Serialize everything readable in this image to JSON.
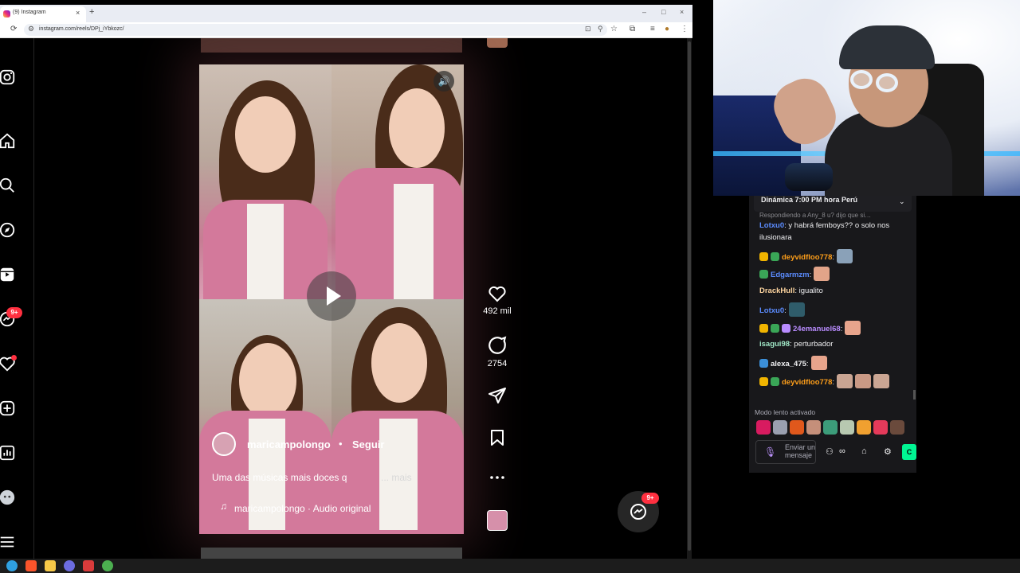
{
  "browser": {
    "tab_title": "(9) Instagram",
    "tab_close": "×",
    "new_tab": "+",
    "url": "instagram.com/reels/DPj_iYbkozc/",
    "win_min": "–",
    "win_max": "□",
    "win_close": "×"
  },
  "sidebar": {
    "messages_badge": "9+"
  },
  "reel": {
    "author": "maricampolongo",
    "separator": "•",
    "follow_label": "Seguir",
    "caption": "Uma das músicas mais doces q",
    "caption_more": "... mais",
    "audio": "maricampolongo · Audio original"
  },
  "actions": {
    "likes": "492 mil",
    "comments": "2754"
  },
  "fab": {
    "badge": "9+"
  },
  "chat": {
    "pinned_title": "Dinámica 7:00 PM hora Perú",
    "pinned_reply": "Respondiendo a Any_8 u? dijo que si…",
    "messages": [
      {
        "user": "Lotxu0",
        "text": ": y habrá femboys?? o solo nos ilusionara",
        "color": "#5b8cff"
      },
      {
        "user": "deyvidfloo778",
        "text": ":",
        "color": "#ff9f1a"
      },
      {
        "user": "Edgarmzm",
        "text": ":",
        "color": "#5b8cff"
      },
      {
        "user": "DrackHull",
        "text": ": igualito",
        "color": "#ffd6a0"
      },
      {
        "user": "Lotxu0",
        "text": ":",
        "color": "#5b8cff"
      },
      {
        "user": "24emanuel68",
        "text": ":",
        "color": "#b98cff"
      },
      {
        "user": "isagui98",
        "text": ": perturbador",
        "color": "#9fe6c6"
      },
      {
        "user": "alexa_475",
        "text": ":",
        "color": "#efeff1"
      },
      {
        "user": "deyvidfloo778",
        "text": ":",
        "color": "#ff9f1a"
      }
    ],
    "slow_mode": "Modo lento activado",
    "input_placeholder": "Enviar un mensaje",
    "send_label": "C"
  }
}
